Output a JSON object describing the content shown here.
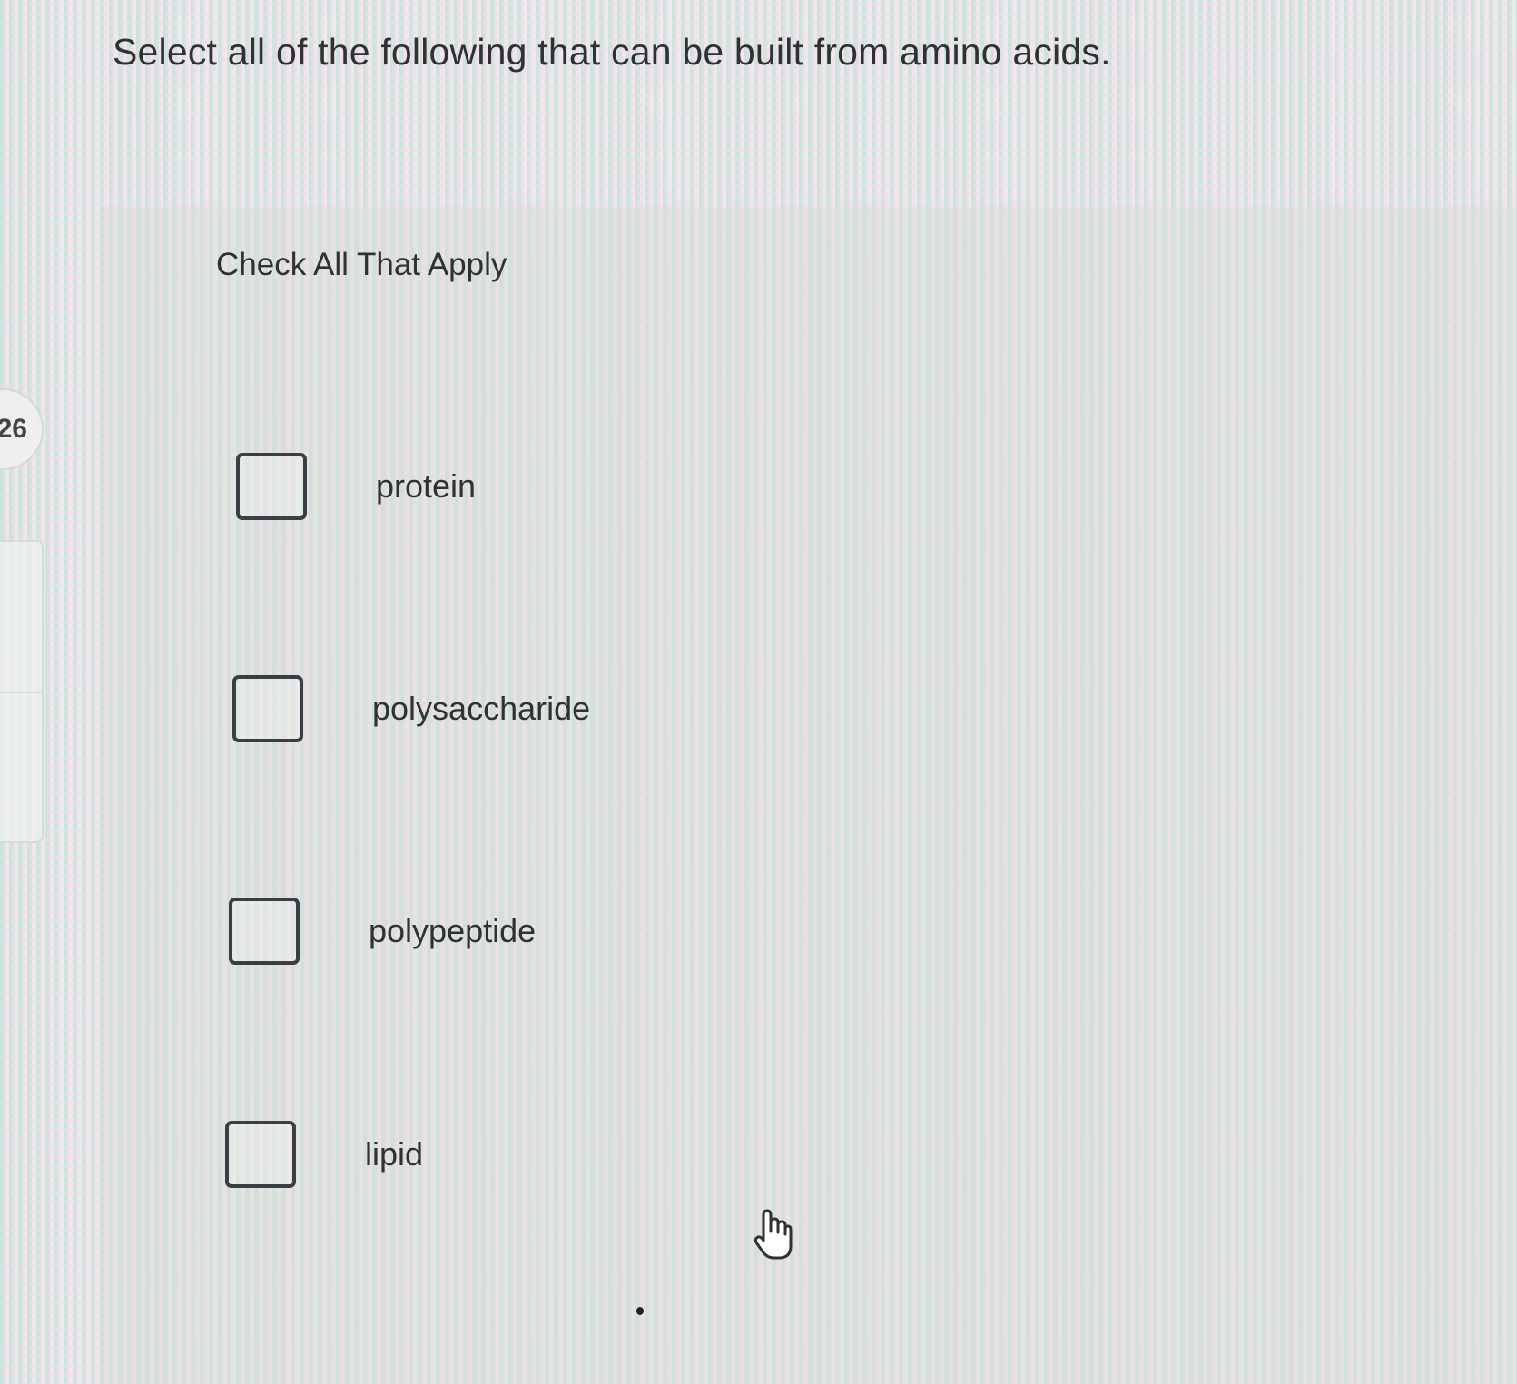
{
  "question": {
    "number": "26",
    "text": "Select all of the following that can be built from amino acids."
  },
  "answer_panel": {
    "instructions": "Check All That Apply",
    "options": [
      {
        "label": "protein",
        "checked": false
      },
      {
        "label": "polysaccharide",
        "checked": false
      },
      {
        "label": "polypeptide",
        "checked": false
      },
      {
        "label": "lipid",
        "checked": false
      }
    ]
  },
  "icons": {
    "cursor": "hand-pointer-icon"
  }
}
